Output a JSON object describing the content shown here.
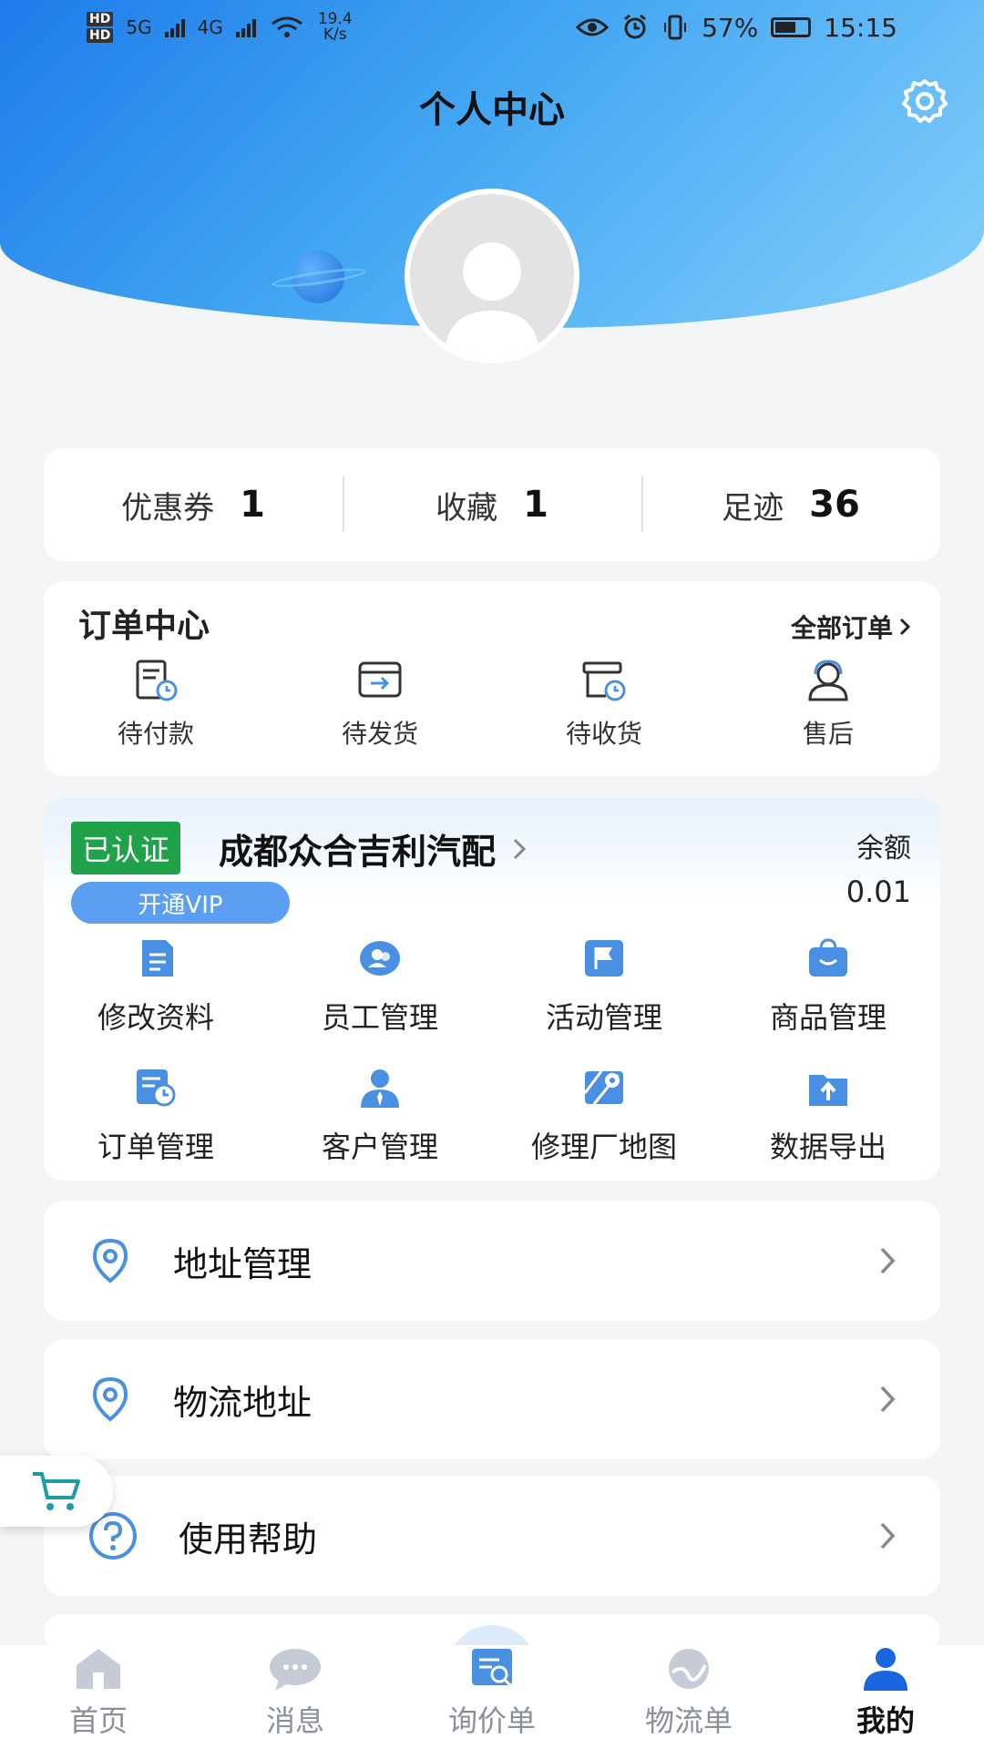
{
  "status_bar": {
    "hd1": "HD",
    "hd2": "HD",
    "net1": "5G",
    "net2": "4G",
    "speed_value": "19.4",
    "speed_unit": "K/s",
    "battery": "57%",
    "time": "15:15"
  },
  "header": {
    "title": "个人中心"
  },
  "stats": [
    {
      "label": "优惠券",
      "value": "1"
    },
    {
      "label": "收藏",
      "value": "1"
    },
    {
      "label": "足迹",
      "value": "36"
    }
  ],
  "orders": {
    "title": "订单中心",
    "all_label": "全部订单",
    "items": [
      {
        "label": "待付款",
        "icon": "pending-payment-icon"
      },
      {
        "label": "待发货",
        "icon": "pending-shipment-icon"
      },
      {
        "label": "待收货",
        "icon": "pending-receipt-icon"
      },
      {
        "label": "售后",
        "icon": "after-sales-icon"
      }
    ]
  },
  "business": {
    "verified_badge": "已认证",
    "shop_name": "成都众合吉利汽配",
    "balance_label": "余额",
    "balance_value": "0.01",
    "vip_button": "开通VIP",
    "grid": [
      {
        "label": "修改资料",
        "icon": "edit-profile-icon"
      },
      {
        "label": "员工管理",
        "icon": "staff-icon"
      },
      {
        "label": "活动管理",
        "icon": "flag-icon"
      },
      {
        "label": "商品管理",
        "icon": "shopping-bag-icon"
      },
      {
        "label": "订单管理",
        "icon": "order-manage-icon"
      },
      {
        "label": "客户管理",
        "icon": "customer-icon"
      },
      {
        "label": "修理厂地图",
        "icon": "map-icon"
      },
      {
        "label": "数据导出",
        "icon": "export-icon"
      }
    ]
  },
  "menu": [
    {
      "label": "地址管理",
      "icon": "location-pin-icon"
    },
    {
      "label": "物流地址",
      "icon": "location-pin-icon"
    },
    {
      "label": "使用帮助",
      "icon": "help-icon"
    }
  ],
  "tabbar": [
    {
      "label": "首页",
      "icon": "home-icon"
    },
    {
      "label": "消息",
      "icon": "message-icon"
    },
    {
      "label": "询价单",
      "icon": "inquiry-icon"
    },
    {
      "label": "物流单",
      "icon": "logistics-icon"
    },
    {
      "label": "我的",
      "icon": "profile-icon",
      "active": true
    }
  ],
  "colors": {
    "accent": "#4a90e2",
    "verified_green": "#1fa24a",
    "vip_blue": "#5c9ef2"
  }
}
